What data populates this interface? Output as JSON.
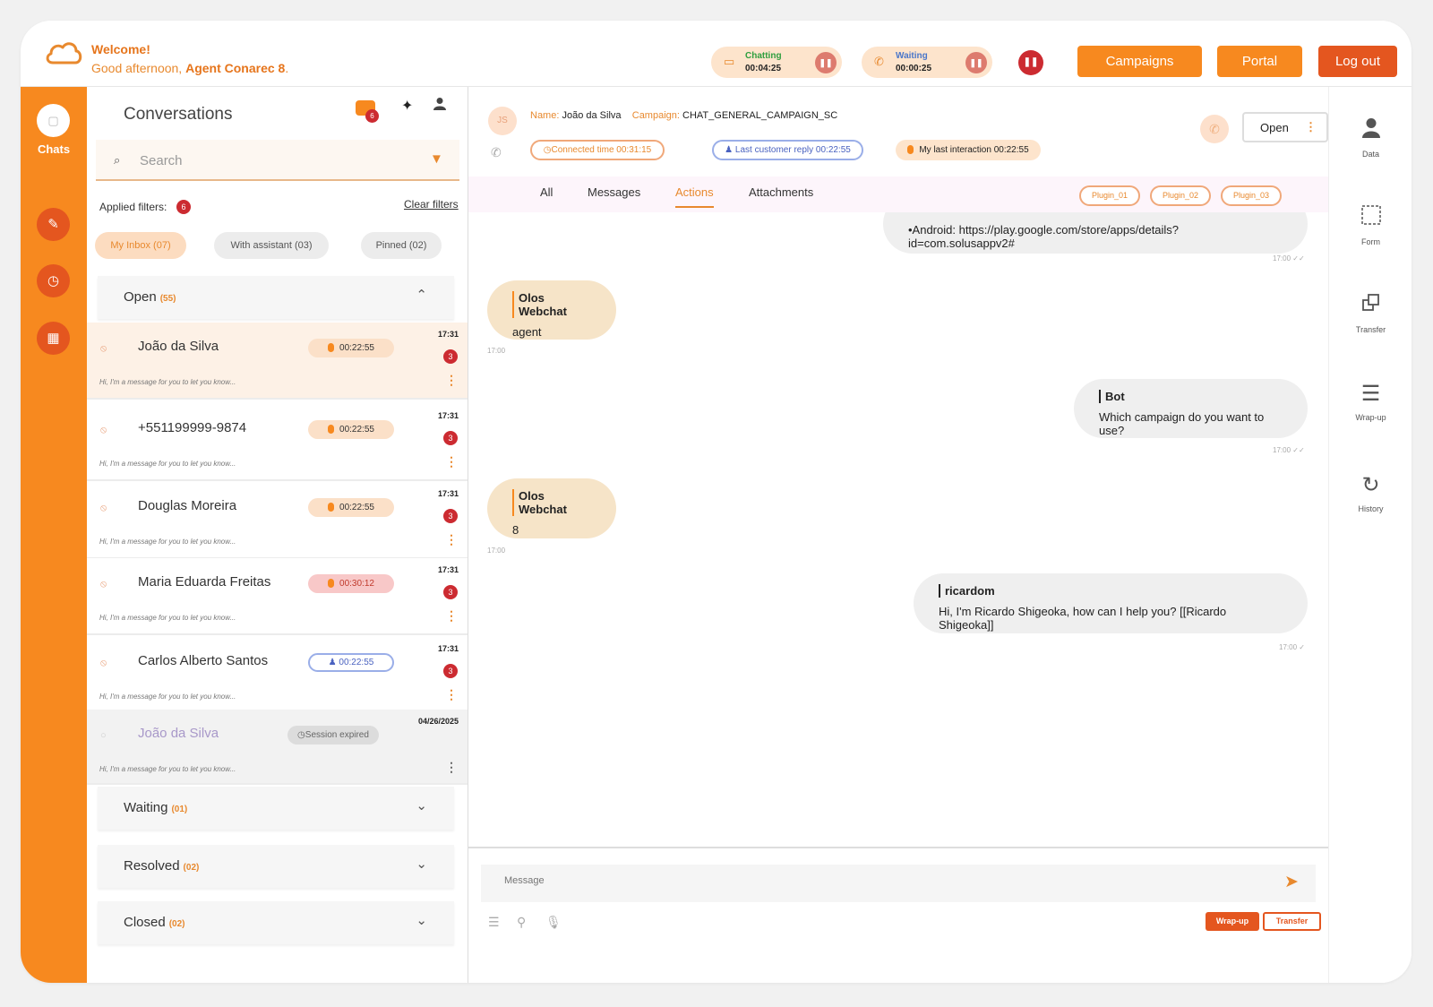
{
  "header": {
    "welcome": "Welcome!",
    "greeting_prefix": "Good afternoon, ",
    "agent_name": "Agent Conarec 8",
    "greeting_suffix": ".",
    "status_chatting": {
      "label": "Chatting",
      "time": "00:04:25",
      "color": "#2e9e3e"
    },
    "status_waiting": {
      "label": "Waiting",
      "time": "00:00:25",
      "color": "#4a76c9"
    },
    "buttons": {
      "campaigns": "Campaigns",
      "portal": "Portal",
      "logout": "Log out"
    },
    "colors": {
      "primary": "#f7891f",
      "logout": "#e4561f",
      "alert": "#cc2b31"
    }
  },
  "rail": {
    "chats_label": "Chats"
  },
  "conversations": {
    "title": "Conversations",
    "notif_count": "6",
    "search_placeholder": "Search",
    "applied_label": "Applied filters:",
    "applied_count": "6",
    "clear_filters": "Clear filters",
    "chips": [
      "My Inbox (07)",
      "With assistant (03)",
      "Pinned (02)"
    ],
    "sections": {
      "open": {
        "name": "Open",
        "count": "(55)"
      },
      "waiting": {
        "name": "Waiting",
        "count": "(01)"
      },
      "resolved": {
        "name": "Resolved",
        "count": "(02)"
      },
      "closed": {
        "name": "Closed",
        "count": "(02)"
      }
    },
    "items": [
      {
        "name": "João da Silva",
        "timer": "00:22:55",
        "time": "17:31",
        "count": "3",
        "preview": "Hi, I'm a message for you to let you know..."
      },
      {
        "name": "+551199999-9874",
        "timer": "00:22:55",
        "time": "17:31",
        "count": "3",
        "preview": "Hi, I'm a message for you to let you know..."
      },
      {
        "name": "Douglas Moreira",
        "timer": "00:22:55",
        "time": "17:31",
        "count": "3",
        "preview": "Hi, I'm a message for you to let you know..."
      },
      {
        "name": "Maria Eduarda Freitas",
        "timer": "00:30:12",
        "time": "17:31",
        "count": "3",
        "preview": "Hi, I'm a message for you to let you know..."
      },
      {
        "name": "Carlos Alberto Santos",
        "timer": "00:22:55",
        "time": "17:31",
        "count": "3",
        "preview": "Hi, I'm a message for you to let you know..."
      },
      {
        "name": "João da Silva",
        "timer": "Session expired",
        "time": "04/26/2025",
        "count": "",
        "preview": "Hi, I'm a message for you to let you know..."
      }
    ]
  },
  "chat": {
    "avatar_initials": "JS",
    "name_label": "Name:",
    "name": "João da Silva",
    "campaign_label": "Campaign:",
    "campaign": "CHAT_GENERAL_CAMPAIGN_SC",
    "connected": "Connected time 00:31:15",
    "last_reply": "Last customer reply 00:22:55",
    "last_interaction": "My last interaction 00:22:55",
    "open_label": "Open",
    "tabs": [
      "All",
      "Messages",
      "Actions",
      "Attachments"
    ],
    "plugins": [
      "Plugin_01",
      "Plugin_02",
      "Plugin_03"
    ],
    "messages": [
      {
        "sender": "",
        "text": "•Android: https://play.google.com/store/apps/details?id=com.solusappv2#",
        "time": "17:00 ✓✓"
      },
      {
        "sender": "Olos Webchat",
        "text": "agent",
        "time": "17:00"
      },
      {
        "sender": "Bot",
        "text": "Which campaign do you want to use?",
        "time": "17:00 ✓✓"
      },
      {
        "sender": "Olos Webchat",
        "text": "8",
        "time": "17:00"
      },
      {
        "sender": "ricardom",
        "text": "Hi, I'm Ricardo Shigeoka, how can I help you? [[Ricardo Shigeoka]]",
        "time": "17:00 ✓"
      }
    ],
    "composer_placeholder": "Message",
    "wrapup_label": "Wrap-up",
    "transfer_label": "Transfer"
  },
  "right_rail": [
    {
      "label": "Data",
      "icon": "person-icon"
    },
    {
      "label": "Form",
      "icon": "form-icon"
    },
    {
      "label": "Transfer",
      "icon": "transfer-icon"
    },
    {
      "label": "Wrap-up",
      "icon": "list-icon"
    },
    {
      "label": "History",
      "icon": "history-icon"
    }
  ]
}
